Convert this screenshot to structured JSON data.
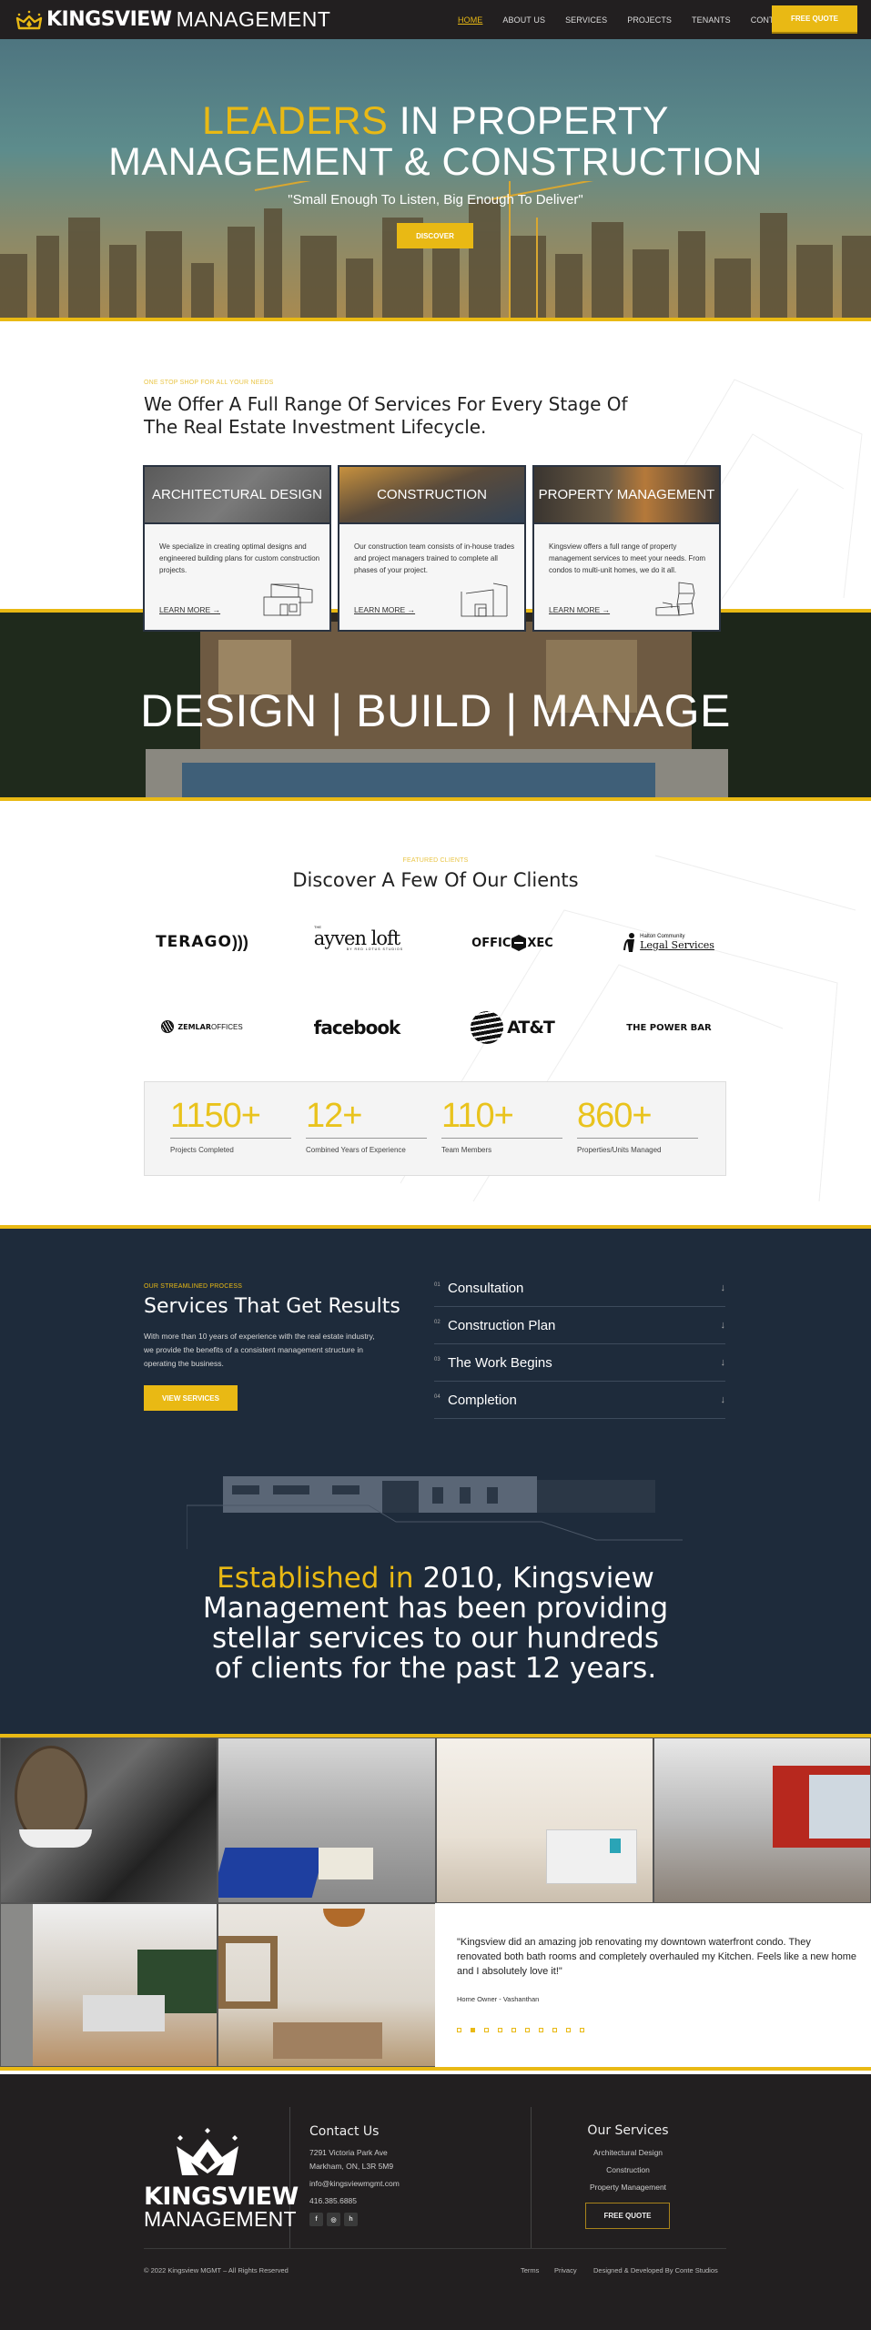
{
  "colors": {
    "accent": "#e9b914",
    "dark": "#221f20",
    "navy": "#1e2b3b"
  },
  "nav": {
    "brand_bold": "KINGSVIEW",
    "brand_light": "MANAGEMENT",
    "items": [
      "HOME",
      "ABOUT US",
      "SERVICES",
      "PROJECTS",
      "TENANTS",
      "CONTACT"
    ],
    "active": "HOME",
    "cta": "FREE QUOTE"
  },
  "hero": {
    "title_highlight": "LEADERS",
    "title_rest_line1": " IN PROPERTY",
    "title_line2": "MANAGEMENT & CONSTRUCTION",
    "tagline": "\"Small Enough To Listen, Big Enough To Deliver\"",
    "button": "DISCOVER"
  },
  "services": {
    "eyebrow": "ONE STOP SHOP FOR ALL YOUR NEEDS",
    "title": "We Offer A Full Range Of Services For Every Stage Of The Real Estate Investment Lifecycle.",
    "cards": [
      {
        "title": "ARCHITECTURAL DESIGN",
        "text": "We specialize in creating optimal designs and engineered building plans for custom construction projects.",
        "link": "LEARN MORE →"
      },
      {
        "title": "CONSTRUCTION",
        "text": "Our construction team consists of in-house trades and project managers trained to complete all phases of your project.",
        "link": "LEARN MORE →"
      },
      {
        "title": "PROPERTY MANAGEMENT",
        "text": "Kingsview offers a full range of property management services to meet your needs. From condos to multi-unit homes, we do it all.",
        "link": "LEARN MORE →"
      }
    ]
  },
  "banner": {
    "text": "DESIGN | BUILD | MANAGE"
  },
  "clients": {
    "eyebrow": "FEATURED CLIENTS",
    "title": "Discover A Few Of Our Clients",
    "logos": [
      "TERAGO",
      "ayven loft",
      "OFFICEXEC",
      "Halton Community Legal Services",
      "ZEMLAROFFICES",
      "facebook",
      "AT&T",
      "THE POWER BAR"
    ],
    "logo_details": {
      "ayven_small_top": "THE",
      "ayven_small_bottom": "BY RED LOTUS STUDIOS",
      "halton_top": "Halton Community",
      "halton_bottom": "Legal Services",
      "officexec_left": "OFFIC",
      "officexec_right": "XEC",
      "zemlar_bold": "ZEMLAR",
      "zemlar_light": "OFFICES",
      "terago": "TERAGO",
      "facebook": "facebook",
      "att": "AT&T",
      "powerbar": "THE POWER BAR"
    }
  },
  "stats": [
    {
      "value": "1150+",
      "label": "Projects Completed"
    },
    {
      "value": "12+",
      "label": "Combined Years of Experience"
    },
    {
      "value": "110+",
      "label": "Team Members"
    },
    {
      "value": "860+",
      "label": "Properties/Units Managed"
    }
  ],
  "process": {
    "eyebrow": "OUR STREAMLINED PROCESS",
    "title": "Services That Get Results",
    "description": "With more than 10 years of experience with the real estate industry, we provide the benefits of a consistent management structure in operating the business.",
    "button": "VIEW SERVICES",
    "steps": [
      {
        "num": "01",
        "label": "Consultation"
      },
      {
        "num": "02",
        "label": "Construction Plan"
      },
      {
        "num": "03",
        "label": "The Work Begins"
      },
      {
        "num": "04",
        "label": "Completion"
      }
    ],
    "established_highlight": "Established in",
    "established_rest": " 2010, Kingsview Management has been providing stellar services to our hundreds of clients for the past 12 years."
  },
  "testimonial": {
    "quote": "\"Kingsview did an amazing job renovating my downtown waterfront condo. They renovated both bath rooms and completely overhauled my Kitchen. Feels like a new home and I absolutely love it!\"",
    "author": "Home Owner - Vashanthan",
    "slide_count": 10,
    "active_slide": 2
  },
  "footer": {
    "brand_bold": "KINGSVIEW",
    "brand_light": "MANAGEMENT",
    "contact_title": "Contact Us",
    "address1": "7291 Victoria Park Ave",
    "address2": "Markham, ON, L3R 5M9",
    "email": "info@kingsviewmgmt.com",
    "phone": "416.385.6885",
    "social": [
      "facebook",
      "instagram",
      "houzz"
    ],
    "services_title": "Our Services",
    "services": [
      "Architectural Design",
      "Construction",
      "Property Management"
    ],
    "cta": "FREE QUOTE",
    "copyright": "© 2022 Kingsview MGMT – All Rights Reserved",
    "links": [
      "Terms",
      "Privacy",
      "Designed & Developed By Conte Studios"
    ]
  }
}
